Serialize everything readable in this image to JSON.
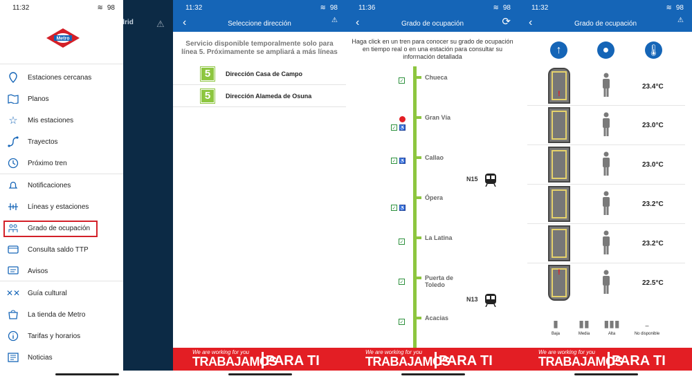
{
  "statusbar": {
    "time1": "11:32",
    "time2": "11:32",
    "time3": "11:36",
    "time4": "11:32",
    "battery": "98"
  },
  "panel1": {
    "backdrop_title": "drid",
    "menu": [
      "Estaciones cercanas",
      "Planos",
      "Mis estaciones",
      "Trayectos",
      "Próximo tren",
      "Notificaciones",
      "Líneas y estaciones",
      "Grado de ocupación",
      "Consulta saldo TTP",
      "Avisos",
      "Guía cultural",
      "La tienda de Metro",
      "Tarifas y horarios",
      "Noticias"
    ],
    "logo_text": "Metro"
  },
  "panel2": {
    "title": "Seleccione dirección",
    "notice": "Servicio disponible temporalmente solo para línea 5. Próximamente se ampliará a más líneas",
    "line_number": "5",
    "directions": [
      "Dirección Casa de Campo",
      "Dirección Alameda de Osuna"
    ]
  },
  "panel3": {
    "title": "Grado de ocupación",
    "instruction": "Haga click en un tren para conocer su grado de ocupación en tiempo real o en una estación para consultar su información detallada",
    "stations": [
      "Chueca",
      "Gran Vía",
      "Callao",
      "Ópera",
      "La Latina",
      "Puerta de Toledo",
      "Acacias"
    ],
    "trains": [
      "N15",
      "N13"
    ]
  },
  "panel4": {
    "title": "Grado de ocupación",
    "temps": [
      "23.4°C",
      "23.0°C",
      "23.0°C",
      "23.2°C",
      "23.2°C",
      "22.5°C"
    ],
    "legend": [
      "Baja",
      "Media",
      "Alta",
      "No disponible"
    ],
    "legend_dash": "–"
  },
  "banner": {
    "small": "We are working for you",
    "big": "TRABAJAMOS",
    "big2": "PARA TI"
  },
  "colors": {
    "blue": "#1565b7",
    "green": "#8dc63f",
    "red": "#e31e24"
  }
}
